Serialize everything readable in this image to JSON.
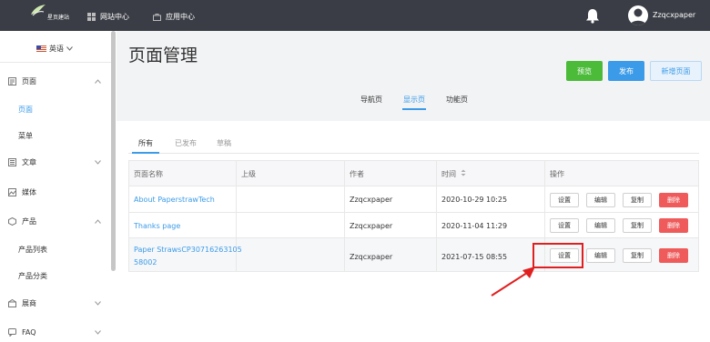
{
  "topbar": {
    "logo_text": "星页建站",
    "nav": [
      {
        "label": "网站中心",
        "icon": "grid-icon"
      },
      {
        "label": "应用中心",
        "icon": "bag-icon"
      }
    ],
    "username": "Zzqcxpaper"
  },
  "sidebar": {
    "language": "英语",
    "items": [
      {
        "label": "页面",
        "icon": "page-icon",
        "expanded": true
      },
      {
        "label": "文章",
        "icon": "article-icon",
        "expanded": false
      },
      {
        "label": "媒体",
        "icon": "media-icon"
      },
      {
        "label": "产品",
        "icon": "product-icon",
        "expanded": true
      },
      {
        "label": "展商",
        "icon": "exhibitor-icon",
        "expanded": false
      },
      {
        "label": "FAQ",
        "icon": "faq-icon",
        "expanded": false
      }
    ],
    "sub_page": [
      "页面",
      "菜单"
    ],
    "sub_product": [
      "产品列表",
      "产品分类"
    ]
  },
  "main": {
    "title": "页面管理",
    "buttons": {
      "preview": "预览",
      "publish": "发布",
      "new_page": "新增页面"
    },
    "mode_tabs": [
      "导航页",
      "显示页",
      "功能页"
    ],
    "active_mode_tab": "显示页",
    "status_tabs": [
      "所有",
      "已发布",
      "草稿"
    ],
    "active_status_tab": "所有",
    "table": {
      "headers": [
        "页面名称",
        "上级",
        "作者",
        "时间",
        "操作"
      ],
      "sort_icon": "sort-icon",
      "action_labels": {
        "settings": "设置",
        "edit": "编辑",
        "copy": "复制",
        "delete": "删除"
      },
      "rows": [
        {
          "name": "About PaperstrawTech",
          "name_line2": "",
          "parent": "",
          "author": "Zzqcxpaper",
          "time": "2020-10-29 10:25"
        },
        {
          "name": "Thanks page",
          "name_line2": "",
          "parent": "",
          "author": "Zzqcxpaper",
          "time": "2020-11-04 11:29"
        },
        {
          "name": "Paper StrawsCP30716263105",
          "name_line2": "58002",
          "parent": "",
          "author": "Zzqcxpaper",
          "time": "2021-07-15 08:55"
        }
      ]
    }
  },
  "colors": {
    "accent": "#3b9be8",
    "success": "#4cbb3a",
    "danger": "#ef5a5a",
    "topbar": "#3a3d45",
    "annotation": "#e02020"
  }
}
